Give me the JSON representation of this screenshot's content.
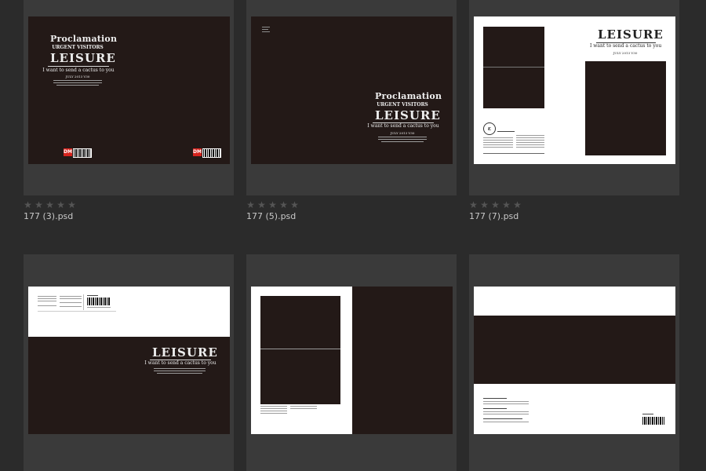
{
  "cover": {
    "proclamation": "Proclamation",
    "urgent": "URGENT VISITORS",
    "leisure": "LEISURE",
    "want": "I want to send a cactus to you",
    "date": "JULY 2013 V30",
    "logo": "DM"
  },
  "items": [
    {
      "filename": "177 (3).psd",
      "rating": "★★★★★"
    },
    {
      "filename": "177 (5).psd",
      "rating": "★★★★★"
    },
    {
      "filename": "177 (7).psd",
      "rating": "★★★★★"
    },
    {
      "filename": "",
      "rating": ""
    },
    {
      "filename": "",
      "rating": ""
    },
    {
      "filename": "",
      "rating": ""
    }
  ],
  "colors": {
    "background": "#2b2b2b",
    "tile": "#3a3a3a",
    "page_dark": "#231917",
    "page_white": "#ffffff",
    "logo_red": "#d6241e",
    "filename_text": "#c8c8c8"
  }
}
